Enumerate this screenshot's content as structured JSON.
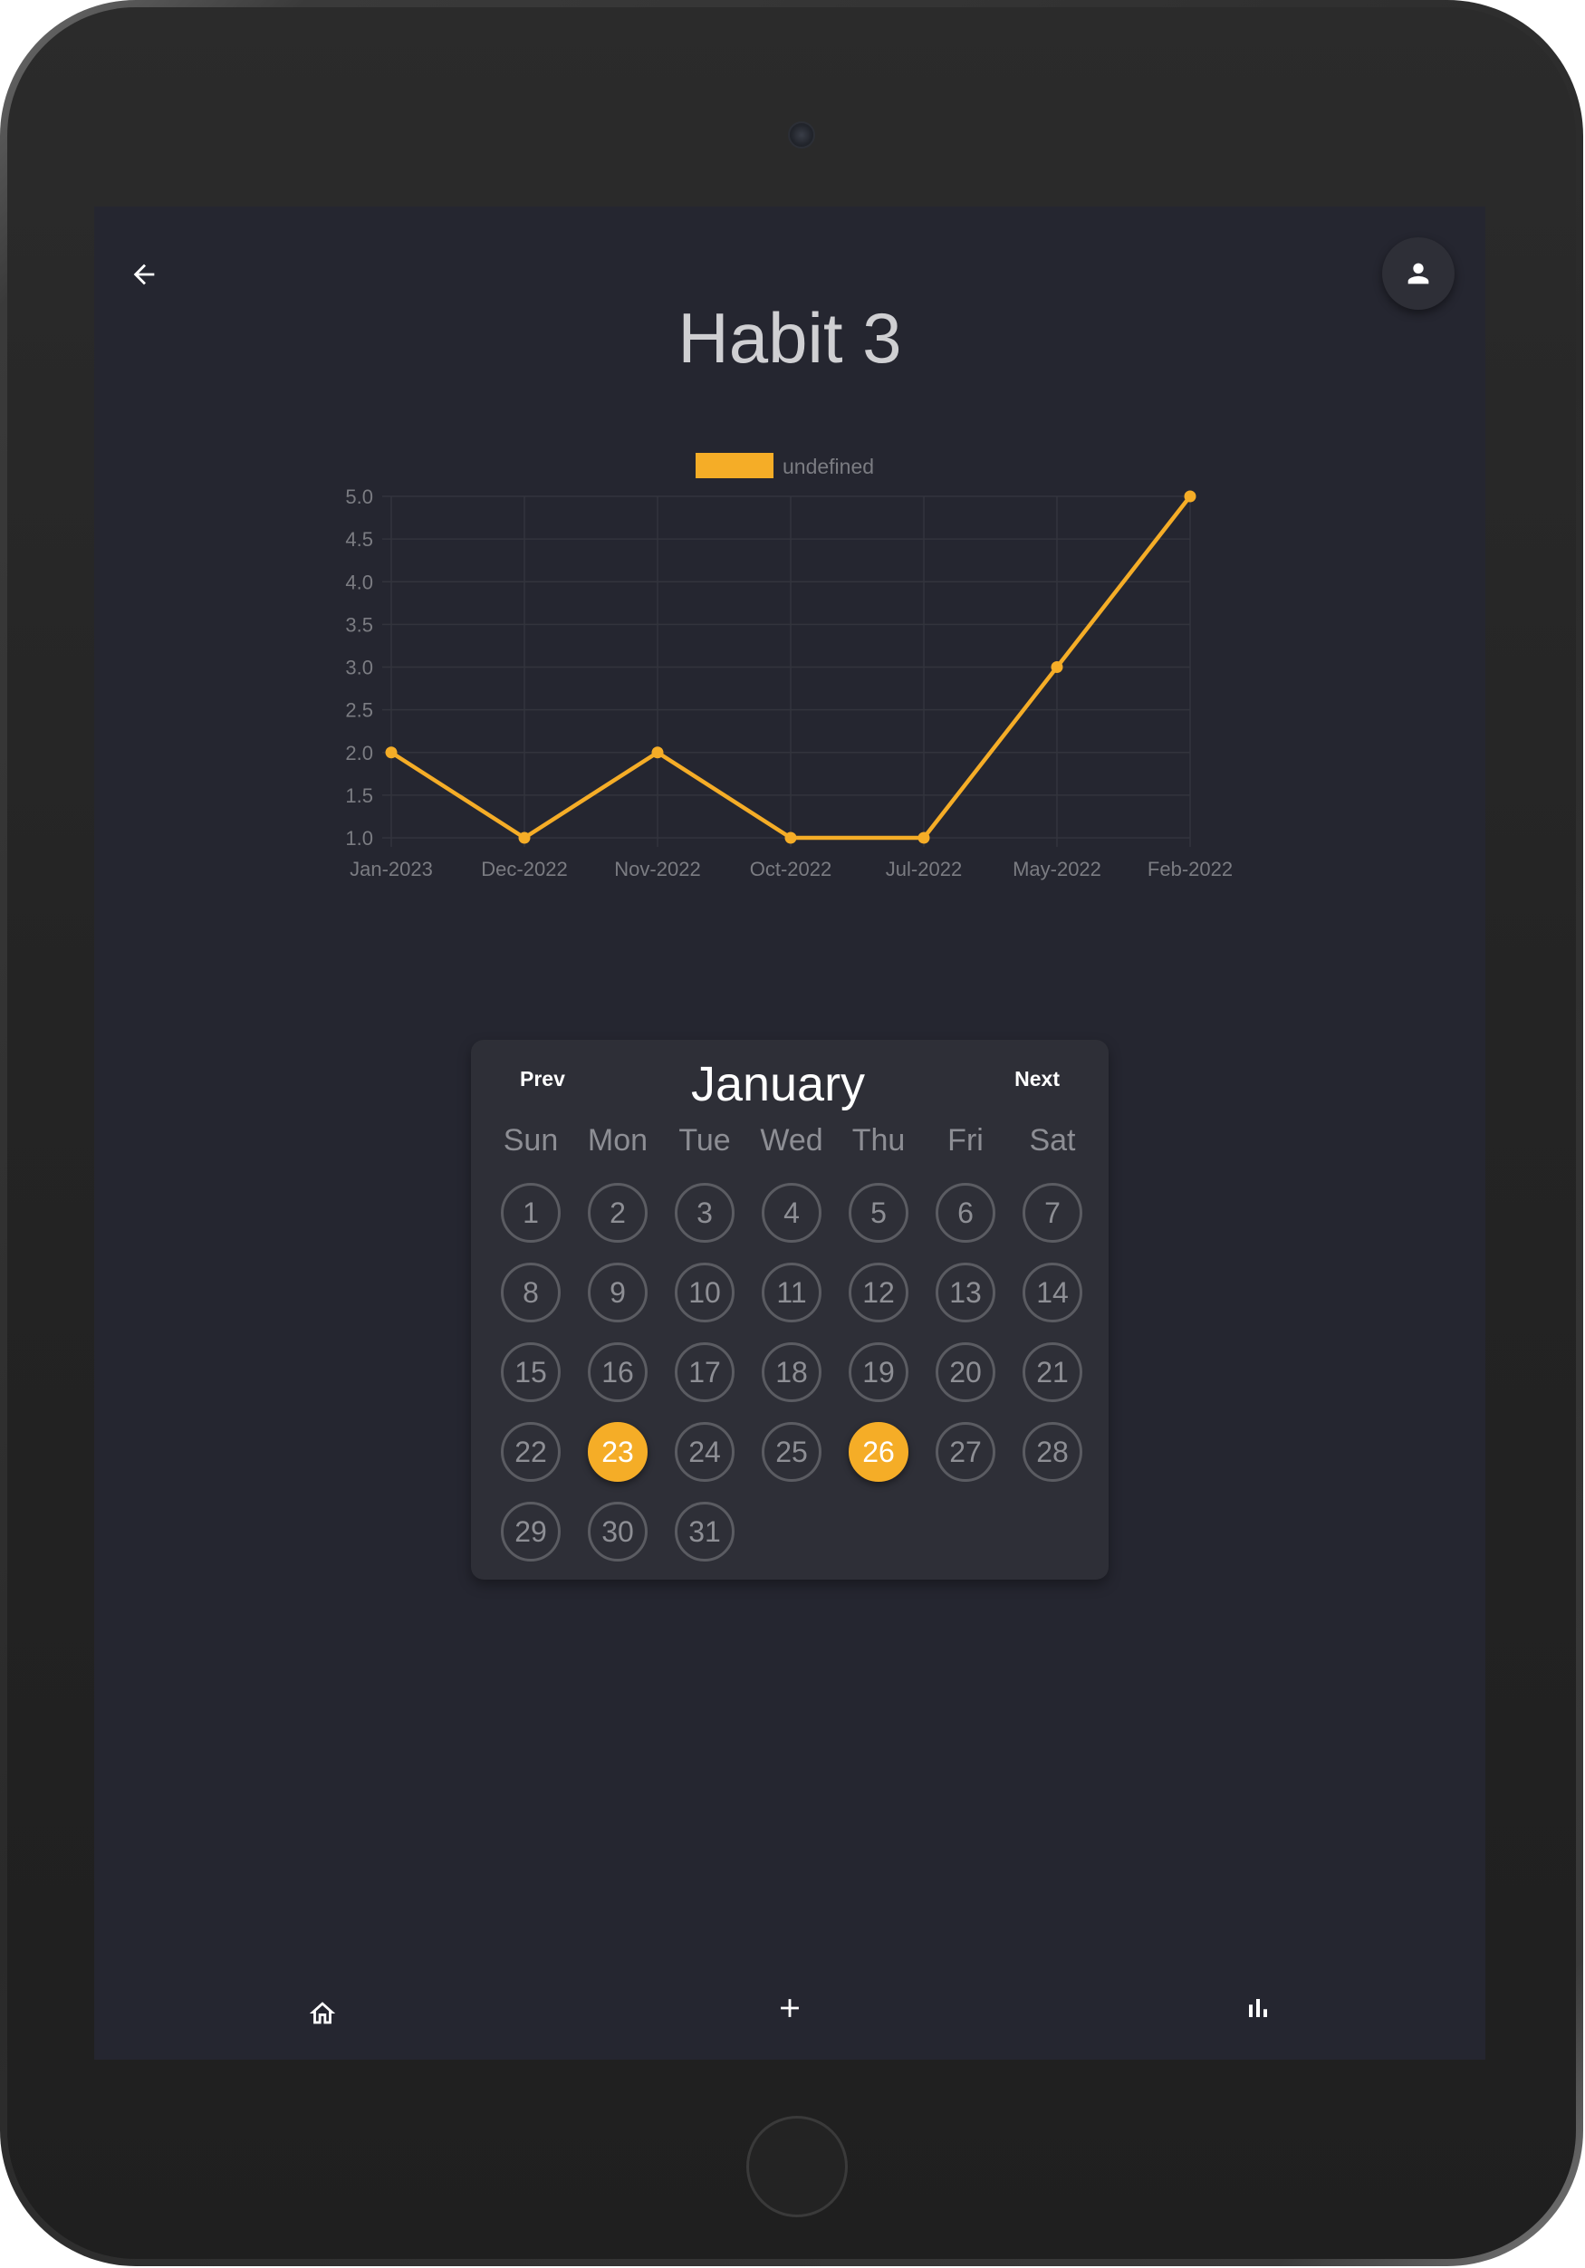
{
  "page": {
    "title": "Habit 3"
  },
  "icons": {
    "back": "arrow-left-icon",
    "profile": "person-icon",
    "home": "home-icon",
    "add": "plus-icon",
    "stats": "bar-chart-icon"
  },
  "colors": {
    "accent": "#f5ad27",
    "background": "#252630",
    "card": "#2e2f37"
  },
  "chart_data": {
    "type": "line",
    "x": [
      "Jan-2023",
      "Dec-2022",
      "Nov-2022",
      "Oct-2022",
      "Jul-2022",
      "May-2022",
      "Feb-2022"
    ],
    "series": [
      {
        "name": "undefined",
        "values": [
          2,
          1,
          2,
          1,
          1,
          3,
          5
        ],
        "color": "#f5ad27"
      }
    ],
    "ylim": [
      1,
      5
    ],
    "yticks": [
      "1.0",
      "1.5",
      "2.0",
      "2.5",
      "3.0",
      "3.5",
      "4.0",
      "4.5",
      "5.0"
    ],
    "legend": "top-center",
    "grid": true
  },
  "calendar": {
    "prev_label": "Prev",
    "next_label": "Next",
    "month": "January",
    "weekdays": [
      "Sun",
      "Mon",
      "Tue",
      "Wed",
      "Thu",
      "Fri",
      "Sat"
    ],
    "weeks": [
      [
        1,
        2,
        3,
        4,
        5,
        6,
        7
      ],
      [
        8,
        9,
        10,
        11,
        12,
        13,
        14
      ],
      [
        15,
        16,
        17,
        18,
        19,
        20,
        21
      ],
      [
        22,
        23,
        24,
        25,
        26,
        27,
        28
      ],
      [
        29,
        30,
        31
      ]
    ],
    "completed_days": [
      23,
      26
    ]
  }
}
